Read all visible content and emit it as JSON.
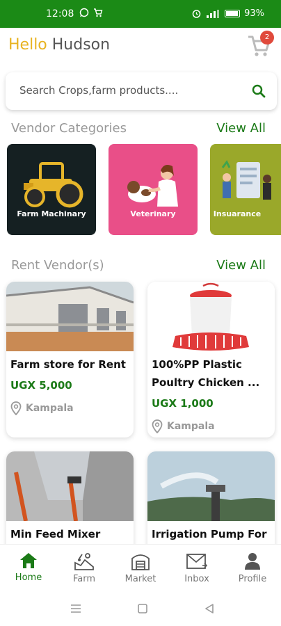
{
  "status_bar": {
    "time": "12:08",
    "battery": "93%"
  },
  "header": {
    "hello": "Hello",
    "name": "Hudson",
    "cart_count": "2"
  },
  "search": {
    "placeholder": "Search Crops,farm products...."
  },
  "vendor_categories": {
    "title": "Vendor Categories",
    "view_all": "View All",
    "items": [
      {
        "label": "Farm Machinary",
        "bg": "#152022"
      },
      {
        "label": "Veterinary",
        "bg": "#e94f88"
      },
      {
        "label": "Insuarance",
        "bg": "#9aa82a"
      }
    ]
  },
  "rent_vendors": {
    "title": "Rent Vendor(s)",
    "view_all": "View All",
    "items": [
      {
        "title": "Farm store for Rent",
        "price": "UGX 5,000",
        "location": "Kampala"
      },
      {
        "title": "100%PP Plastic",
        "title2": "Poultry Chicken ...",
        "price": "UGX 1,000",
        "location": "Kampala"
      },
      {
        "title": "Min Feed Mixer"
      },
      {
        "title": "Irrigation Pump For"
      }
    ]
  },
  "bottom_nav": {
    "items": [
      {
        "label": "Home",
        "active": true
      },
      {
        "label": "Farm"
      },
      {
        "label": "Market"
      },
      {
        "label": "Inbox"
      },
      {
        "label": "Profile"
      }
    ]
  },
  "colors": {
    "brand_green": "#1b8a16",
    "accent_yellow": "#e8b321",
    "badge_red": "#e04a3c"
  }
}
